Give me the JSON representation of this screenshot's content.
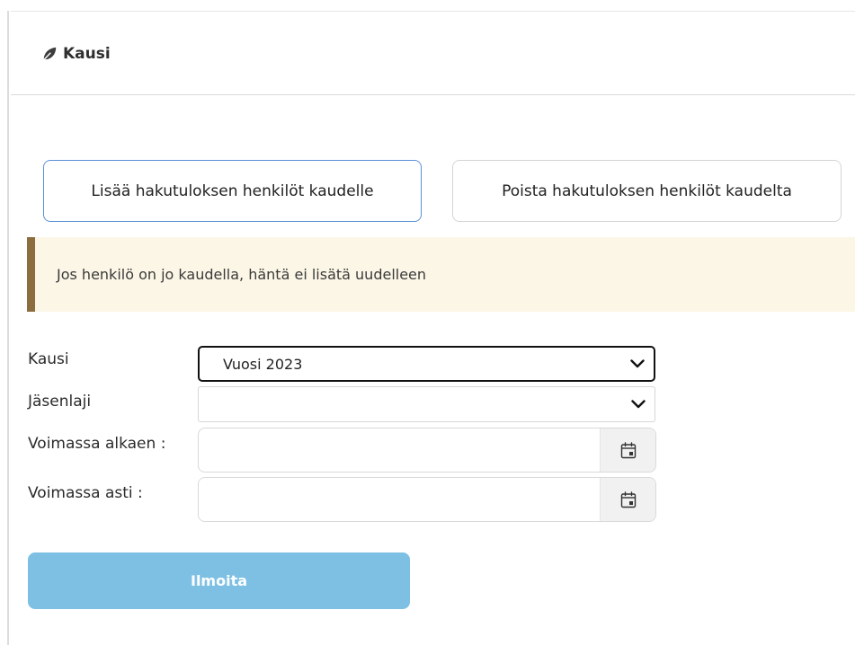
{
  "header": {
    "icon": "leaf-icon",
    "title": "Kausi"
  },
  "actions": {
    "add_label": "Lisää hakutuloksen henkilöt kaudelle",
    "remove_label": "Poista hakutuloksen henkilöt kaudelta"
  },
  "notice": {
    "text": "Jos henkilö on jo kaudella, häntä ei lisätä uudelleen"
  },
  "form": {
    "kausi": {
      "label": "Kausi",
      "value": "Vuosi 2023"
    },
    "jasenlaji": {
      "label": "Jäsenlaji",
      "value": ""
    },
    "voimassa_alkaen": {
      "label": "Voimassa alkaen :",
      "value": ""
    },
    "voimassa_asti": {
      "label": "Voimassa asti :",
      "value": ""
    },
    "submit_label": "Ilmoita"
  },
  "colors": {
    "primary_button": "#7ec0e4",
    "notice_bg": "#fcf6e6",
    "notice_border": "#8c6d3f",
    "focus_border": "#5b8fd6"
  }
}
